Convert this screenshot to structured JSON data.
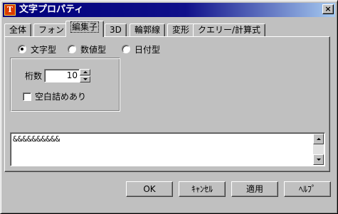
{
  "window": {
    "title": "文字プロパティ",
    "close_glyph": "×",
    "app_icon_glyph": "T"
  },
  "tabs": [
    {
      "label": "全体"
    },
    {
      "label": "フォント"
    },
    {
      "label": "編集子",
      "selected": true
    },
    {
      "label": "3D"
    },
    {
      "label": "輪郭線"
    },
    {
      "label": "変形"
    },
    {
      "label": "クエリー/計算式"
    }
  ],
  "format_type": {
    "options": [
      {
        "label": "文字型",
        "selected": true
      },
      {
        "label": "数値型",
        "selected": false
      },
      {
        "label": "日付型",
        "selected": false
      }
    ]
  },
  "digits": {
    "label": "桁数",
    "value": "10"
  },
  "zero_fill": {
    "label": "空白詰めあり",
    "checked": false
  },
  "format_string": {
    "value": "&&&&&&&&&&"
  },
  "buttons": {
    "ok": "OK",
    "cancel": "ｷｬﾝｾﾙ",
    "apply": "適用",
    "help": "ﾍﾙﾌﾟ"
  },
  "colors": {
    "face": "#c0c0c0",
    "title_active": "#00007b",
    "title_gradient_end": "#a6caf0"
  }
}
